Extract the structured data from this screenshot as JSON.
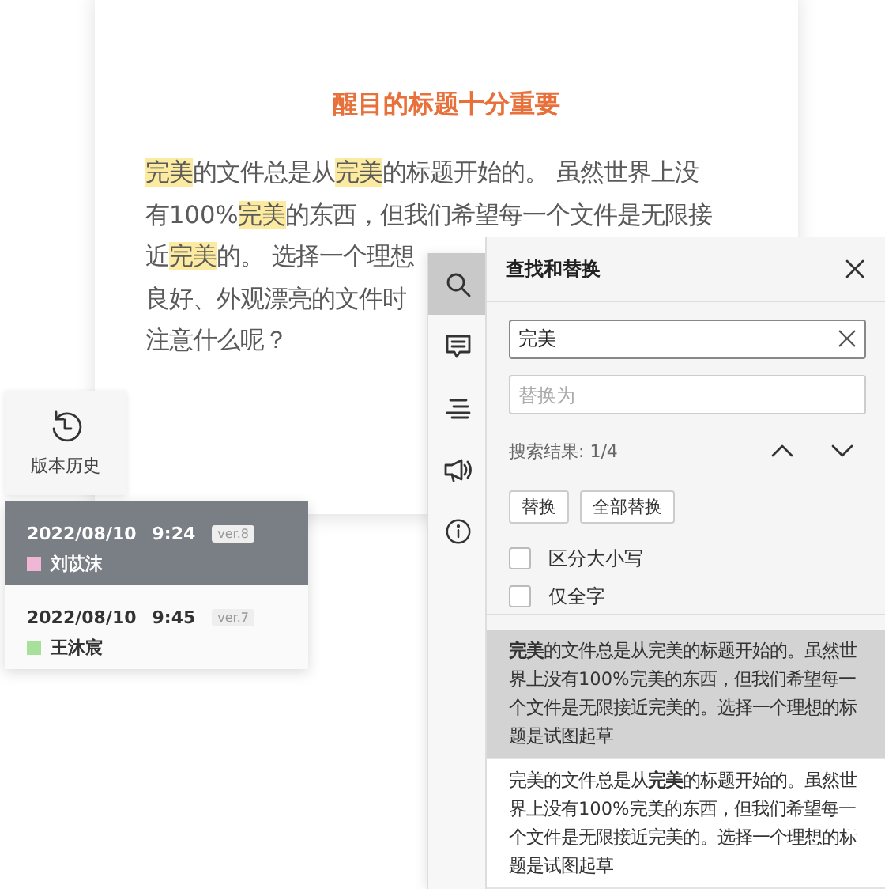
{
  "document": {
    "title": "醒目的标题十分重要",
    "lines": [
      [
        {
          "text": "完美",
          "highlighted": true
        },
        {
          "text": "的文件总是从",
          "highlighted": false
        },
        {
          "text": "完美",
          "highlighted": true
        },
        {
          "text": "的标题开始的。 虽然世界上没",
          "highlighted": false
        }
      ],
      [
        {
          "text": "有100%",
          "highlighted": false
        },
        {
          "text": "完美",
          "highlighted": true
        },
        {
          "text": "的东西，但我们希望每一个文件是无限接",
          "highlighted": false
        }
      ],
      [
        {
          "text": "近",
          "highlighted": false
        },
        {
          "text": "完美",
          "highlighted": true
        },
        {
          "text": "的。 选择一个理想",
          "highlighted": false
        }
      ],
      [
        {
          "text": "良好、外观漂亮的文件时",
          "highlighted": false
        }
      ],
      [
        {
          "text": "注意什么呢？",
          "highlighted": false
        }
      ]
    ]
  },
  "tool_strip": [
    {
      "kind": "search",
      "selected": true
    },
    {
      "kind": "comment",
      "selected": false
    },
    {
      "kind": "outline",
      "selected": false
    },
    {
      "kind": "announce",
      "selected": false
    },
    {
      "kind": "info",
      "selected": false
    }
  ],
  "find_replace": {
    "title": "查找和替换",
    "search_value": "完美",
    "replace_placeholder": "替换为",
    "result_count": "搜索结果: 1/4",
    "buttons": [
      "替换",
      "全部替换"
    ],
    "options": [
      {
        "label": "区分大小写",
        "checked": false
      },
      {
        "label": "仅全字",
        "checked": false
      }
    ],
    "results": [
      {
        "text": "**完美**的文件总是从完美的标题开始的。虽然世界上没有100%完美的东西，但我们希望每一个文件是无限接近完美的。选择一个理想的标题是试图起草",
        "selected": true
      },
      {
        "text": "完美的文件总是从**完美**的标题开始的。虽然世界上没有100%完美的东西，但我们希望每一个文件是无限接近完美的。选择一个理想的标题是试图起草",
        "selected": false
      }
    ]
  },
  "version_history": {
    "label": "版本历史",
    "versions": [
      {
        "date": "2022/08/10",
        "time": "9:24",
        "version": "ver.8",
        "author": "刘苡沫",
        "color": "#efb6d6",
        "selected": true
      },
      {
        "date": "2022/08/10",
        "time": "9:45",
        "version": "ver.7",
        "author": "王沐宸",
        "color": "#a6e09a",
        "selected": false
      }
    ]
  }
}
